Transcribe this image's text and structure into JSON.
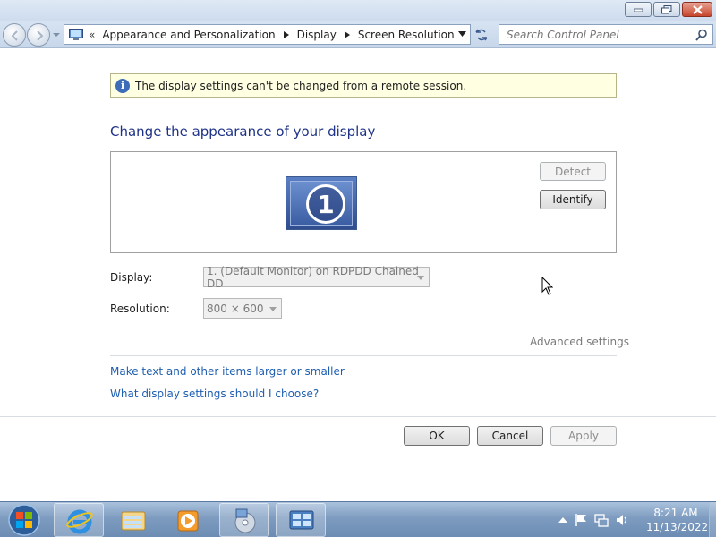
{
  "addressbar": {
    "crumbs": [
      "Appearance and Personalization",
      "Display",
      "Screen Resolution"
    ],
    "overflow": "«"
  },
  "search": {
    "placeholder": "Search Control Panel"
  },
  "info": {
    "message": "The display settings can't be changed from a remote session."
  },
  "main": {
    "heading": "Change the appearance of your display",
    "monitor_number": "1",
    "detect_label": "Detect",
    "identify_label": "Identify",
    "display_label": "Display:",
    "display_value": "1. (Default Monitor) on RDPDD Chained DD",
    "resolution_label": "Resolution:",
    "resolution_value": "800 × 600",
    "advanced_settings": "Advanced settings",
    "link_larger_text": "Make text and other items larger or smaller",
    "link_which_settings": "What display settings should I choose?"
  },
  "footer": {
    "ok": "OK",
    "cancel": "Cancel",
    "apply": "Apply"
  },
  "taskbar": {
    "time": "8:21 AM",
    "date": "11/13/2022"
  },
  "colors": {
    "heading": "#1e3287",
    "link": "#1e5eb0",
    "infobar_bg": "#ffffe1",
    "taskbar": "#7e9cc0"
  },
  "icons": [
    "control-panel-icon",
    "refresh-icon",
    "search-icon",
    "info-icon",
    "monitor-icon",
    "windows-start-icon",
    "internet-explorer-icon",
    "explorer-icon",
    "media-player-icon",
    "dvd-maker-icon",
    "control-panel-taskbar-icon",
    "flag-icon",
    "network-icon",
    "volume-icon"
  ]
}
